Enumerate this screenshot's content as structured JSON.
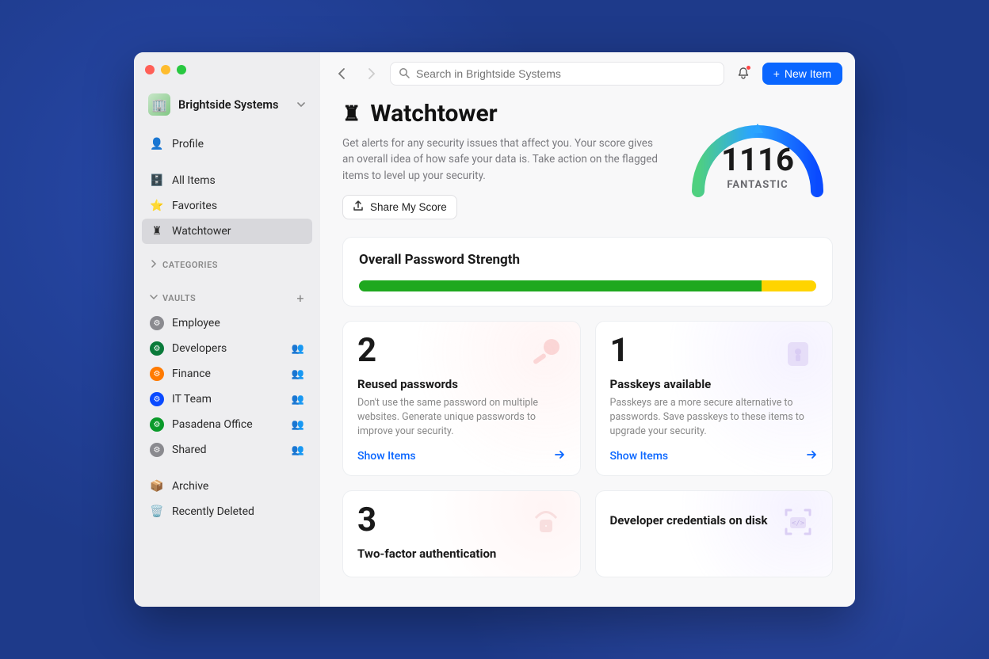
{
  "account": {
    "name": "Brightside Systems"
  },
  "sidebar": {
    "profile": "Profile",
    "items": [
      {
        "label": "All Items"
      },
      {
        "label": "Favorites"
      },
      {
        "label": "Watchtower"
      }
    ],
    "categories_label": "CATEGORIES",
    "vaults_label": "VAULTS",
    "vaults": [
      {
        "label": "Employee",
        "color": "#8a8a8f",
        "shared": false
      },
      {
        "label": "Developers",
        "color": "#0a7a3a",
        "shared": true
      },
      {
        "label": "Finance",
        "color": "#ff7a00",
        "shared": true
      },
      {
        "label": "IT Team",
        "color": "#0a4aff",
        "shared": true
      },
      {
        "label": "Pasadena Office",
        "color": "#0a9a2a",
        "shared": true
      },
      {
        "label": "Shared",
        "color": "#8a8a8f",
        "shared": true
      }
    ],
    "archive": "Archive",
    "deleted": "Recently Deleted"
  },
  "topbar": {
    "search_placeholder": "Search in Brightside Systems",
    "new_item": "New Item"
  },
  "hero": {
    "title": "Watchtower",
    "description": "Get alerts for any security issues that affect you. Your score gives an overall idea of how safe your data is. Take action on the flagged items to level up your security.",
    "share_label": "Share My Score",
    "score": "1116",
    "score_label": "FANTASTIC"
  },
  "overall": {
    "title": "Overall Password Strength"
  },
  "issues": [
    {
      "count": "2",
      "title": "Reused passwords",
      "desc": "Don't use the same password on multiple websites. Generate unique passwords to improve your security.",
      "link": "Show Items"
    },
    {
      "count": "1",
      "title": "Passkeys available",
      "desc": "Passkeys are a more secure alternative to passwords. Save passkeys to these items to upgrade your security.",
      "link": "Show Items"
    },
    {
      "count": "3",
      "title": "Two-factor authentication",
      "desc": "",
      "link": ""
    },
    {
      "count": "",
      "title": "Developer credentials on disk",
      "desc": "",
      "link": ""
    }
  ]
}
